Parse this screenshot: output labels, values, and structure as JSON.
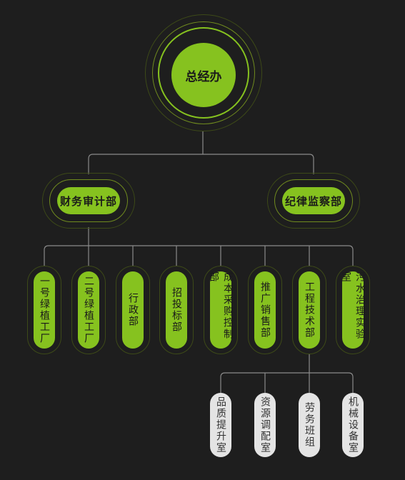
{
  "root": {
    "label": "总经办"
  },
  "level1": [
    {
      "label": "财务审计部"
    },
    {
      "label": "纪律监察部"
    }
  ],
  "level2": [
    {
      "label": "一号绿植工厂"
    },
    {
      "label": "二号绿植工厂"
    },
    {
      "label": "行政部"
    },
    {
      "label": "招投标部"
    },
    {
      "label": "成本采购控制部"
    },
    {
      "label": "推广销售部"
    },
    {
      "label": "工程技术部"
    },
    {
      "label": "污水治理实验室"
    }
  ],
  "level3": [
    {
      "label": "品质提升室"
    },
    {
      "label": "资源调配室"
    },
    {
      "label": "劳务班组"
    },
    {
      "label": "机械设备室"
    }
  ],
  "colors": {
    "accent": "#86c21f",
    "background": "#1e1e1e",
    "line": "#8a8a8a",
    "leaf": "#e4e4e4"
  }
}
